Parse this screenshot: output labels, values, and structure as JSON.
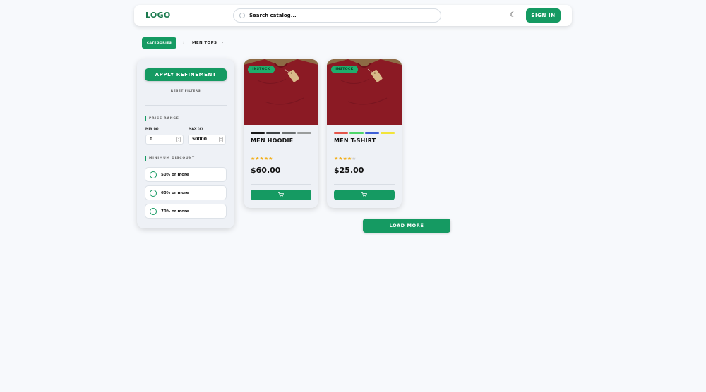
{
  "header": {
    "logo": "LOGO",
    "search_placeholder": "Search catalog...",
    "theme_icon": "moon-icon",
    "signin_label": "SIGN IN"
  },
  "breadcrumb": {
    "categories": "CATEGORIES",
    "current": "MEN TOPS",
    "separator": "›"
  },
  "sidebar": {
    "apply_label": "APPLY REFINEMENT",
    "reset_label": "RESET FILTERS",
    "price_title": "PRICE RANGE",
    "min_label": "MIN ($)",
    "max_label": "MAX ($)",
    "min_value": "0",
    "max_value": "50000",
    "discount_title": "MINIMUM DISCOUNT",
    "discounts": [
      "50% or more",
      "60% or more",
      "70% or more"
    ]
  },
  "products": [
    {
      "title": "MEN HOODIE",
      "badge": "INSTOCK",
      "price": "$60.00",
      "rating": 5,
      "stars": "★★★★★",
      "stars_empty": "",
      "swatches": [
        "#1a1a1a",
        "#3f4447",
        "#6b7071",
        "#9a9d9d"
      ],
      "cart_icon": "cart-icon"
    },
    {
      "title": "MEN T-SHIRT",
      "badge": "INSTOCK",
      "price": "$25.00",
      "rating": 4,
      "stars": "★★★★",
      "stars_empty": "★",
      "swatches": [
        "#e5564b",
        "#4fd66a",
        "#3e5fd6",
        "#f2e43a"
      ],
      "cart_icon": "cart-icon"
    }
  ],
  "load_more_label": "LOAD MORE",
  "colors": {
    "accent": "#159a62",
    "shirt": "#8b1a24"
  }
}
